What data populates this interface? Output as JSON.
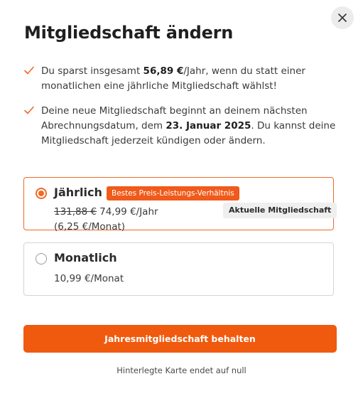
{
  "dialog": {
    "title": "Mitgliedschaft ändern",
    "close_icon": "close-icon"
  },
  "benefits": [
    {
      "icon": "check-icon",
      "text_before": "Du sparst insgesamt ",
      "highlight": "56,89 €",
      "text_after": "/Jahr, wenn du statt einer monatlichen eine jährliche Mitgliedschaft wählst!"
    },
    {
      "icon": "check-icon",
      "text_before": "Deine neue Mitgliedschaft beginnt an deinem nächsten Abrechnungsdatum, dem ",
      "highlight": "23. Januar 2025",
      "text_after": ". Du kannst deine Mitgliedschaft jederzeit kündigen oder ändern."
    }
  ],
  "plans": {
    "yearly": {
      "name": "Jährlich",
      "selected": true,
      "badge": "Bestes Preis-Leistungs-Verhältnis",
      "current_badge": "Aktuelle Mitgliedschaft",
      "old_price": "131,88 €",
      "price": "74,99 €/Jahr",
      "price_per_month": "(6,25 €/Monat)"
    },
    "monthly": {
      "name": "Monatlich",
      "selected": false,
      "price": "10,99 €/Monat"
    }
  },
  "cta": {
    "label": "Jahresmitgliedschaft behalten"
  },
  "footer": {
    "note": "Hinterlegte Karte endet auf null"
  },
  "colors": {
    "accent": "#f05a0e",
    "selected_border": "#f06a26",
    "badge_bg": "#f05a1a"
  }
}
